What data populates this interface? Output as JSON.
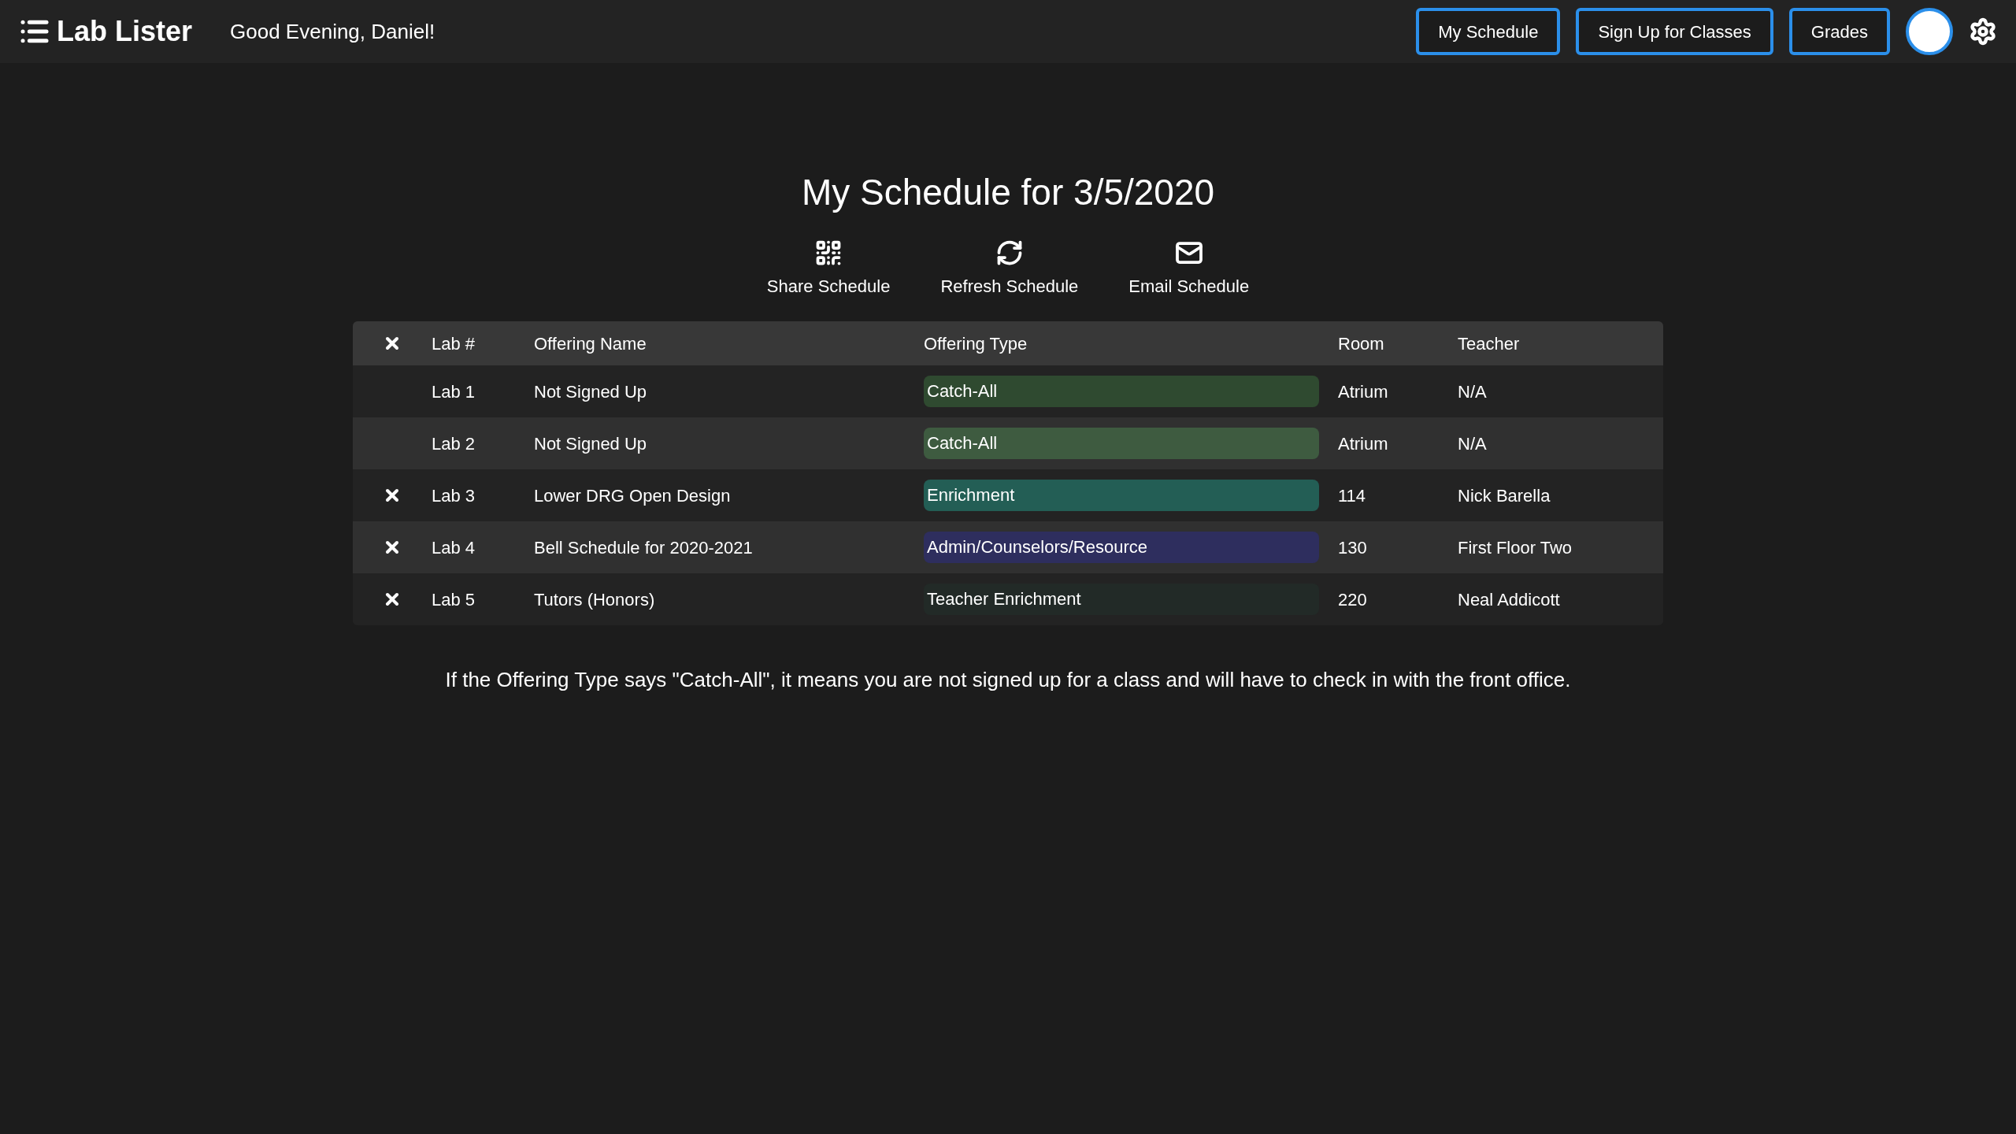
{
  "app": {
    "title": "Lab Lister",
    "greeting": "Good Evening, Daniel!"
  },
  "nav_buttons": [
    "My Schedule",
    "Sign Up for Classes",
    "Grades"
  ],
  "heading": "My Schedule for 3/5/2020",
  "actions": [
    {
      "kind": "share",
      "label": "Share Schedule"
    },
    {
      "kind": "refresh",
      "label": "Refresh Schedule"
    },
    {
      "kind": "email",
      "label": "Email Schedule"
    }
  ],
  "table": {
    "columns": [
      "Lab #",
      "Offering Name",
      "Offering Type",
      "Room",
      "Teacher"
    ],
    "rows": [
      {
        "removable": false,
        "lab": "Lab 1",
        "name": "Not Signed Up",
        "type": "Catch-All",
        "color": "#2f4a30",
        "room": "Atrium",
        "teacher": "N/A"
      },
      {
        "removable": false,
        "lab": "Lab 2",
        "name": "Not Signed Up",
        "type": "Catch-All",
        "color": "#3e5b40",
        "room": "Atrium",
        "teacher": "N/A"
      },
      {
        "removable": true,
        "lab": "Lab 3",
        "name": "Lower DRG Open Design",
        "type": "Enrichment",
        "color": "#235e55",
        "room": "114",
        "teacher": "Nick Barella"
      },
      {
        "removable": true,
        "lab": "Lab 4",
        "name": "Bell Schedule for 2020-2021",
        "type": "Admin/Counselors/Resource",
        "color": "#2e2e5e",
        "room": "130",
        "teacher": "First Floor Two"
      },
      {
        "removable": true,
        "lab": "Lab 5",
        "name": "Tutors (Honors)",
        "type": "Teacher Enrichment",
        "color": "#222a27",
        "room": "220",
        "teacher": "Neal Addicott"
      }
    ]
  },
  "note": "If the Offering Type says \"Catch-All\", it means you are not signed up for a class and will have to check in with the front office."
}
